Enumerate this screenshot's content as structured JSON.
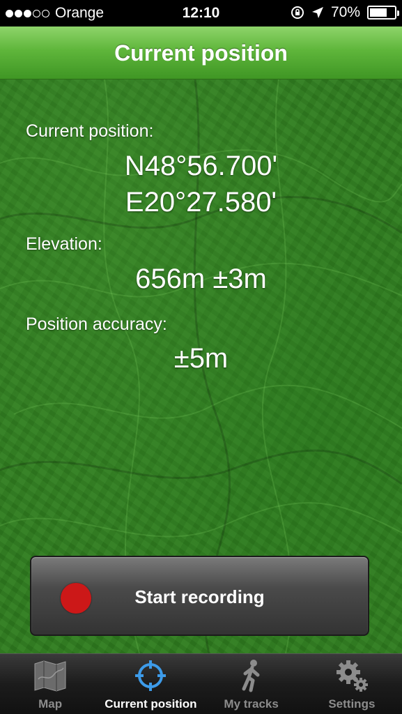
{
  "status_bar": {
    "carrier": "Orange",
    "time": "12:10",
    "battery": "70%",
    "signal_bars_filled": 3,
    "signal_bars_total": 5,
    "battery_level": 0.7
  },
  "nav": {
    "title": "Current position"
  },
  "position": {
    "label": "Current position:",
    "latitude": "N48°56.700'",
    "longitude": "E20°27.580'"
  },
  "elevation": {
    "label": "Elevation:",
    "value": "656m ±3m"
  },
  "accuracy": {
    "label": "Position accuracy:",
    "value": "±5m"
  },
  "record_button": {
    "label": "Start recording",
    "color": "#cc1818"
  },
  "tabs": [
    {
      "label": "Map",
      "icon": "map-icon",
      "active": false
    },
    {
      "label": "Current position",
      "icon": "crosshair-icon",
      "active": true
    },
    {
      "label": "My tracks",
      "icon": "walking-person-icon",
      "active": false
    },
    {
      "label": "Settings",
      "icon": "gear-icon",
      "active": false
    }
  ],
  "colors": {
    "nav_green": "#5fb63b",
    "map_green": "#2f7d1f",
    "active_tab_blue": "#3d9be9"
  }
}
